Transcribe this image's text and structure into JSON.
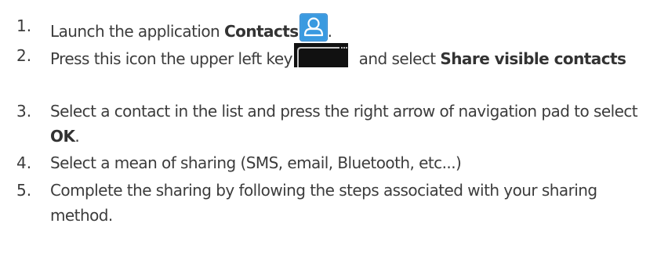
{
  "steps": [
    {
      "number": "1.",
      "parts": {
        "a": "Launch the application ",
        "b": "Contacts",
        "c": "."
      },
      "icon": "contacts-app-icon"
    },
    {
      "number": "2.",
      "parts": {
        "a": "Press this icon the upper left key",
        "b": " and select ",
        "c": "Share visible contacts"
      },
      "icon": "menu-key-icon"
    },
    {
      "number": "3.",
      "parts": {
        "a": "Select a contact in the list and press the right arrow of navigation pad to select ",
        "b": "OK",
        "c": "."
      }
    },
    {
      "number": "4.",
      "text": "Select a mean of sharing (SMS, email, Bluetooth, etc...)"
    },
    {
      "number": "5.",
      "text": "Complete the sharing by following the steps associated with your sharing method."
    }
  ],
  "colors": {
    "text": "#3c3c3c",
    "icon_blue": "#3a9ae0",
    "menu_key_black": "#111111"
  }
}
